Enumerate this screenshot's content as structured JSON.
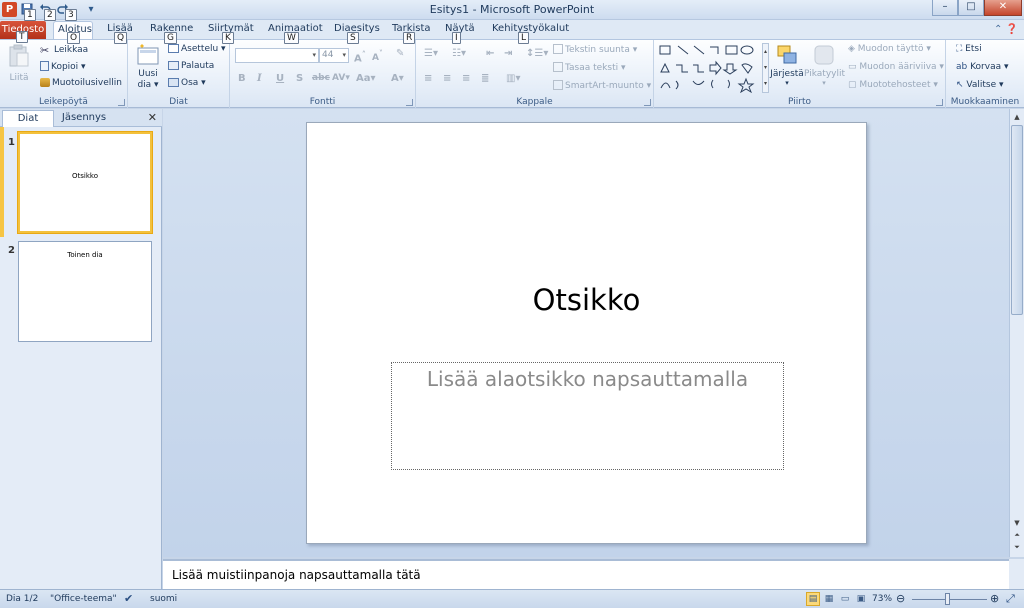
{
  "window": {
    "title": "Esitys1 - Microsoft PowerPoint",
    "app_icon_letter": "P",
    "qat_icons": [
      "save-icon",
      "undo-icon",
      "redo-icon",
      "customize-qat-icon"
    ],
    "controls": {
      "minimize": "–",
      "maximize": "□",
      "close": "✕"
    }
  },
  "keytips": {
    "qat": [
      "1",
      "2",
      "3"
    ],
    "file": "T",
    "tabs": [
      "O",
      "Q",
      "G",
      "K",
      "W",
      "S",
      "R",
      "I",
      "L"
    ]
  },
  "tabs": {
    "file": "Tiedosto",
    "items": [
      "Aloitus",
      "Lisää",
      "Rakenne",
      "Siirtymät",
      "Animaatiot",
      "Diaesitys",
      "Tarkista",
      "Näytä",
      "Kehitystyökalut"
    ],
    "active_index": 0
  },
  "ribbon": {
    "clipboard": {
      "label": "Leikepöytä",
      "paste": "Liitä",
      "cut": "Leikkaa",
      "copy": "Kopioi",
      "format_painter": "Muotoilusivellin"
    },
    "slides": {
      "label": "Diat",
      "new_slide_line1": "Uusi",
      "new_slide_line2": "dia",
      "layout": "Asettelu",
      "reset": "Palauta",
      "section": "Osa"
    },
    "font": {
      "label": "Fontti",
      "font_name": "",
      "font_size": "44",
      "bold": "B",
      "italic": "I",
      "underline": "U",
      "shadow": "S",
      "strike": "abc",
      "spacing": "AV",
      "case": "Aa",
      "color": "A",
      "grow": "A",
      "shrink": "A"
    },
    "paragraph": {
      "label": "Kappale",
      "text_direction": "Tekstin suunta",
      "align_text": "Tasaa teksti",
      "smartart": "SmartArt-muunto"
    },
    "drawing": {
      "label": "Piirto",
      "arrange": "Järjestä",
      "quick_styles": "Pikatyylit",
      "shape_fill": "Muodon täyttö",
      "shape_outline": "Muodon ääriviiva",
      "shape_effects": "Muototehosteet"
    },
    "editing": {
      "label": "Muokkaaminen",
      "find": "Etsi",
      "replace": "Korvaa",
      "select": "Valitse"
    }
  },
  "left_pane": {
    "tabs": [
      "Diat",
      "Jäsennys"
    ],
    "close": "✕",
    "slides": [
      {
        "number": "1",
        "text": "Otsikko"
      },
      {
        "number": "2",
        "text": "Toinen dia"
      }
    ]
  },
  "slide": {
    "title": "Otsikko",
    "subtitle_placeholder": "Lisää alaotsikko napsauttamalla"
  },
  "notes": {
    "placeholder": "Lisää muistiinpanoja napsauttamalla tätä"
  },
  "status": {
    "slide_counter": "Dia 1/2",
    "theme": "\"Office-teema\"",
    "language": "suomi",
    "zoom": "73%",
    "zoom_fraction": 0.47
  }
}
